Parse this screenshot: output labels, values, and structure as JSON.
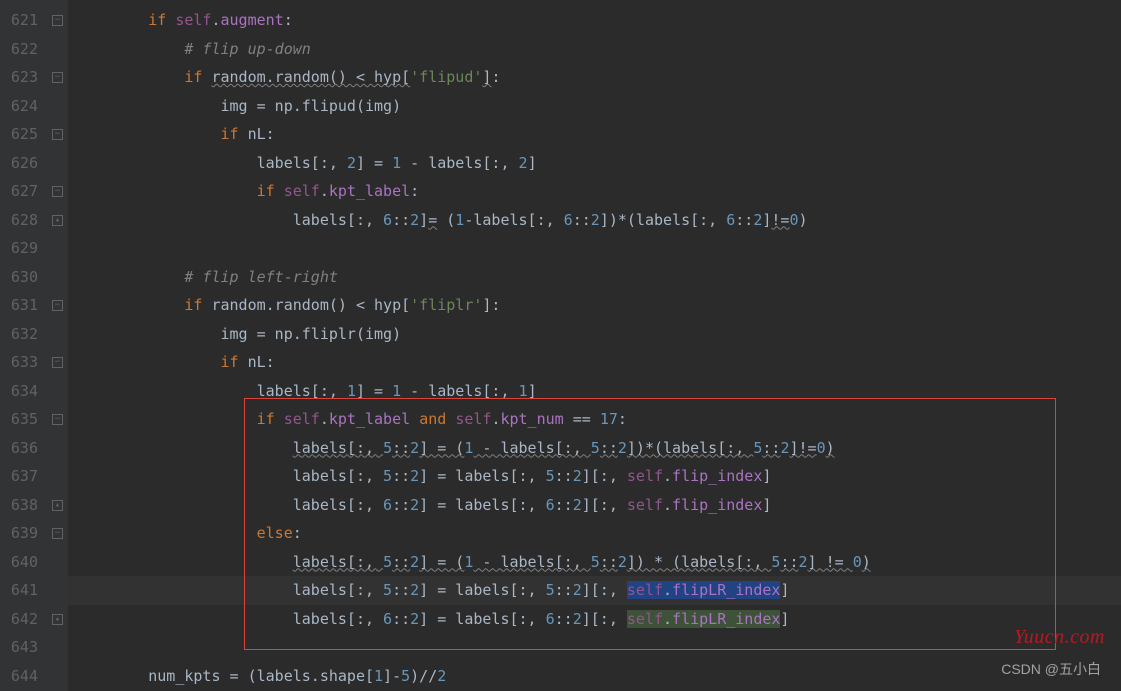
{
  "watermark": "Yuucn.com",
  "csdn": "CSDN @五小白",
  "lines": [
    {
      "n": "621",
      "tokens": [
        [
          "        ",
          "op"
        ],
        [
          "if",
          "kw"
        ],
        [
          " ",
          "op"
        ],
        [
          "self",
          "self"
        ],
        [
          ".",
          "op"
        ],
        [
          "augment",
          "attr"
        ],
        [
          ":",
          "op"
        ]
      ]
    },
    {
      "n": "622",
      "tokens": [
        [
          "            ",
          "op"
        ],
        [
          "# flip up-down",
          "cmt"
        ]
      ]
    },
    {
      "n": "623",
      "tokens": [
        [
          "            ",
          "op"
        ],
        [
          "if",
          "kw"
        ],
        [
          " ",
          "op"
        ],
        [
          "random.random() < hyp[",
          "wavy"
        ],
        [
          "'flipud'",
          "str"
        ],
        [
          "]",
          "wavy"
        ],
        [
          ":",
          "op"
        ]
      ]
    },
    {
      "n": "624",
      "tokens": [
        [
          "                img = np.flipud(img)",
          "op"
        ]
      ]
    },
    {
      "n": "625",
      "tokens": [
        [
          "                ",
          "op"
        ],
        [
          "if",
          "kw"
        ],
        [
          " nL:",
          "op"
        ]
      ]
    },
    {
      "n": "626",
      "tokens": [
        [
          "                    labels[:, ",
          "op"
        ],
        [
          "2",
          "num"
        ],
        [
          "] = ",
          "op"
        ],
        [
          "1",
          "num"
        ],
        [
          " - labels[:, ",
          "op"
        ],
        [
          "2",
          "num"
        ],
        [
          "]",
          "op"
        ]
      ]
    },
    {
      "n": "627",
      "tokens": [
        [
          "                    ",
          "op"
        ],
        [
          "if",
          "kw"
        ],
        [
          " ",
          "op"
        ],
        [
          "self",
          "self"
        ],
        [
          ".",
          "op"
        ],
        [
          "kpt_label",
          "attr"
        ],
        [
          ":",
          "op"
        ]
      ]
    },
    {
      "n": "628",
      "tokens": [
        [
          "                        labels[:, ",
          "op"
        ],
        [
          "6",
          "num"
        ],
        [
          "::",
          "op"
        ],
        [
          "2",
          "num"
        ],
        [
          "]",
          "op"
        ],
        [
          "=",
          "wavy"
        ],
        [
          " (",
          "op"
        ],
        [
          "1",
          "num"
        ],
        [
          "-labels[:, ",
          "op"
        ],
        [
          "6",
          "num"
        ],
        [
          "::",
          "op"
        ],
        [
          "2",
          "num"
        ],
        [
          "])*(labels[:, ",
          "op"
        ],
        [
          "6",
          "num"
        ],
        [
          "::",
          "op"
        ],
        [
          "2",
          "num"
        ],
        [
          "]",
          "op"
        ],
        [
          "!=",
          "wavy"
        ],
        [
          "0",
          "num"
        ],
        [
          ")",
          "op"
        ]
      ]
    },
    {
      "n": "629",
      "tokens": [
        [
          " ",
          "op"
        ]
      ]
    },
    {
      "n": "630",
      "tokens": [
        [
          "            ",
          "op"
        ],
        [
          "# flip left-right",
          "cmt"
        ]
      ]
    },
    {
      "n": "631",
      "tokens": [
        [
          "            ",
          "op"
        ],
        [
          "if",
          "kw"
        ],
        [
          " random.random() < hyp[",
          "op"
        ],
        [
          "'fliplr'",
          "str"
        ],
        [
          "]:",
          "op"
        ]
      ]
    },
    {
      "n": "632",
      "tokens": [
        [
          "                img = np.fliplr(img)",
          "op"
        ]
      ]
    },
    {
      "n": "633",
      "tokens": [
        [
          "                ",
          "op"
        ],
        [
          "if",
          "kw"
        ],
        [
          " nL:",
          "op"
        ]
      ]
    },
    {
      "n": "634",
      "tokens": [
        [
          "                    labels[:, ",
          "op"
        ],
        [
          "1",
          "num"
        ],
        [
          "] = ",
          "op"
        ],
        [
          "1",
          "num"
        ],
        [
          " - labels[:, ",
          "op"
        ],
        [
          "1",
          "num"
        ],
        [
          "]",
          "op"
        ]
      ]
    },
    {
      "n": "635",
      "tokens": [
        [
          "                    ",
          "op"
        ],
        [
          "if",
          "kw"
        ],
        [
          " ",
          "op"
        ],
        [
          "self",
          "self"
        ],
        [
          ".",
          "op"
        ],
        [
          "kpt_label",
          "attr"
        ],
        [
          " ",
          "op"
        ],
        [
          "and",
          "kw"
        ],
        [
          " ",
          "op"
        ],
        [
          "self",
          "self"
        ],
        [
          ".",
          "op"
        ],
        [
          "kpt_num",
          "attr"
        ],
        [
          " == ",
          "op"
        ],
        [
          "17",
          "num"
        ],
        [
          ":",
          "op"
        ]
      ]
    },
    {
      "n": "636",
      "tokens": [
        [
          "                        ",
          "op"
        ],
        [
          "labels[:, ",
          "wavy"
        ],
        [
          "5",
          "num"
        ],
        [
          "::",
          "wavy"
        ],
        [
          "2",
          "num"
        ],
        [
          "] = (",
          "wavy"
        ],
        [
          "1",
          "num"
        ],
        [
          " - labels[:, ",
          "wavy"
        ],
        [
          "5",
          "num"
        ],
        [
          "::",
          "wavy"
        ],
        [
          "2",
          "num"
        ],
        [
          "])*(labels[:, ",
          "wavy"
        ],
        [
          "5",
          "num"
        ],
        [
          "::",
          "wavy"
        ],
        [
          "2",
          "num"
        ],
        [
          "]!=",
          "wavy"
        ],
        [
          "0",
          "num"
        ],
        [
          ")",
          "wavy"
        ]
      ]
    },
    {
      "n": "637",
      "tokens": [
        [
          "                        labels[:, ",
          "op"
        ],
        [
          "5",
          "num"
        ],
        [
          "::",
          "op"
        ],
        [
          "2",
          "num"
        ],
        [
          "] = labels[:, ",
          "op"
        ],
        [
          "5",
          "num"
        ],
        [
          "::",
          "op"
        ],
        [
          "2",
          "num"
        ],
        [
          "][:, ",
          "op"
        ],
        [
          "self",
          "self"
        ],
        [
          ".",
          "op"
        ],
        [
          "flip_index",
          "attr"
        ],
        [
          "]",
          "op"
        ]
      ]
    },
    {
      "n": "638",
      "tokens": [
        [
          "                        labels[:, ",
          "op"
        ],
        [
          "6",
          "num"
        ],
        [
          "::",
          "op"
        ],
        [
          "2",
          "num"
        ],
        [
          "] = labels[:, ",
          "op"
        ],
        [
          "6",
          "num"
        ],
        [
          "::",
          "op"
        ],
        [
          "2",
          "num"
        ],
        [
          "][:, ",
          "op"
        ],
        [
          "self",
          "self"
        ],
        [
          ".",
          "op"
        ],
        [
          "flip_index",
          "attr"
        ],
        [
          "]",
          "op"
        ]
      ]
    },
    {
      "n": "639",
      "tokens": [
        [
          "                    ",
          "op"
        ],
        [
          "else",
          "kw"
        ],
        [
          ":",
          "op"
        ]
      ]
    },
    {
      "n": "640",
      "tokens": [
        [
          "                        ",
          "op"
        ],
        [
          "labels[:, ",
          "wavy"
        ],
        [
          "5",
          "num"
        ],
        [
          "::",
          "wavy"
        ],
        [
          "2",
          "num"
        ],
        [
          "] = (",
          "wavy"
        ],
        [
          "1",
          "num"
        ],
        [
          " - labels[:, ",
          "wavy"
        ],
        [
          "5",
          "num"
        ],
        [
          "::",
          "wavy"
        ],
        [
          "2",
          "num"
        ],
        [
          "]) * (labels[:, ",
          "wavy"
        ],
        [
          "5",
          "num"
        ],
        [
          "::",
          "wavy"
        ],
        [
          "2",
          "num"
        ],
        [
          "] != ",
          "wavy"
        ],
        [
          "0",
          "num"
        ],
        [
          ")",
          "wavy"
        ]
      ]
    },
    {
      "n": "641",
      "hl": true,
      "tokens": [
        [
          "                        labels[:, ",
          "op"
        ],
        [
          "5",
          "num"
        ],
        [
          "::",
          "op"
        ],
        [
          "2",
          "num"
        ],
        [
          "] = labels[:, ",
          "op"
        ],
        [
          "5",
          "num"
        ],
        [
          "::",
          "op"
        ],
        [
          "2",
          "num"
        ],
        [
          "][:, ",
          "op"
        ],
        [
          "self",
          "self sel-write"
        ],
        [
          ".",
          "op sel-write"
        ],
        [
          "flipLR_index",
          "attr sel-write"
        ],
        [
          "]",
          "op"
        ]
      ]
    },
    {
      "n": "642",
      "tokens": [
        [
          "                        labels[:, ",
          "op"
        ],
        [
          "6",
          "num"
        ],
        [
          "::",
          "op"
        ],
        [
          "2",
          "num"
        ],
        [
          "] = labels[:, ",
          "op"
        ],
        [
          "6",
          "num"
        ],
        [
          "::",
          "op"
        ],
        [
          "2",
          "num"
        ],
        [
          "][:, ",
          "op"
        ],
        [
          "self",
          "self sel-read"
        ],
        [
          ".",
          "op sel-read"
        ],
        [
          "flipLR_index",
          "attr sel-read"
        ],
        [
          "]",
          "op"
        ]
      ]
    },
    {
      "n": "643",
      "tokens": [
        [
          " ",
          "op"
        ]
      ]
    },
    {
      "n": "644",
      "tokens": [
        [
          "        num_kpts = (labels.shape[",
          "op"
        ],
        [
          "1",
          "num"
        ],
        [
          "]-",
          "op"
        ],
        [
          "5",
          "num"
        ],
        [
          ")//",
          "op"
        ],
        [
          "2",
          "num"
        ]
      ]
    }
  ],
  "fold_markers": [
    {
      "line": 0,
      "type": "end"
    },
    {
      "line": 2,
      "type": "end"
    },
    {
      "line": 4,
      "type": "end"
    },
    {
      "line": 6,
      "type": "end"
    },
    {
      "line": 7,
      "type": "up"
    },
    {
      "line": 10,
      "type": "end"
    },
    {
      "line": 12,
      "type": "end"
    },
    {
      "line": 14,
      "type": "end"
    },
    {
      "line": 17,
      "type": "up"
    },
    {
      "line": 18,
      "type": "end"
    },
    {
      "line": 21,
      "type": "up"
    }
  ]
}
